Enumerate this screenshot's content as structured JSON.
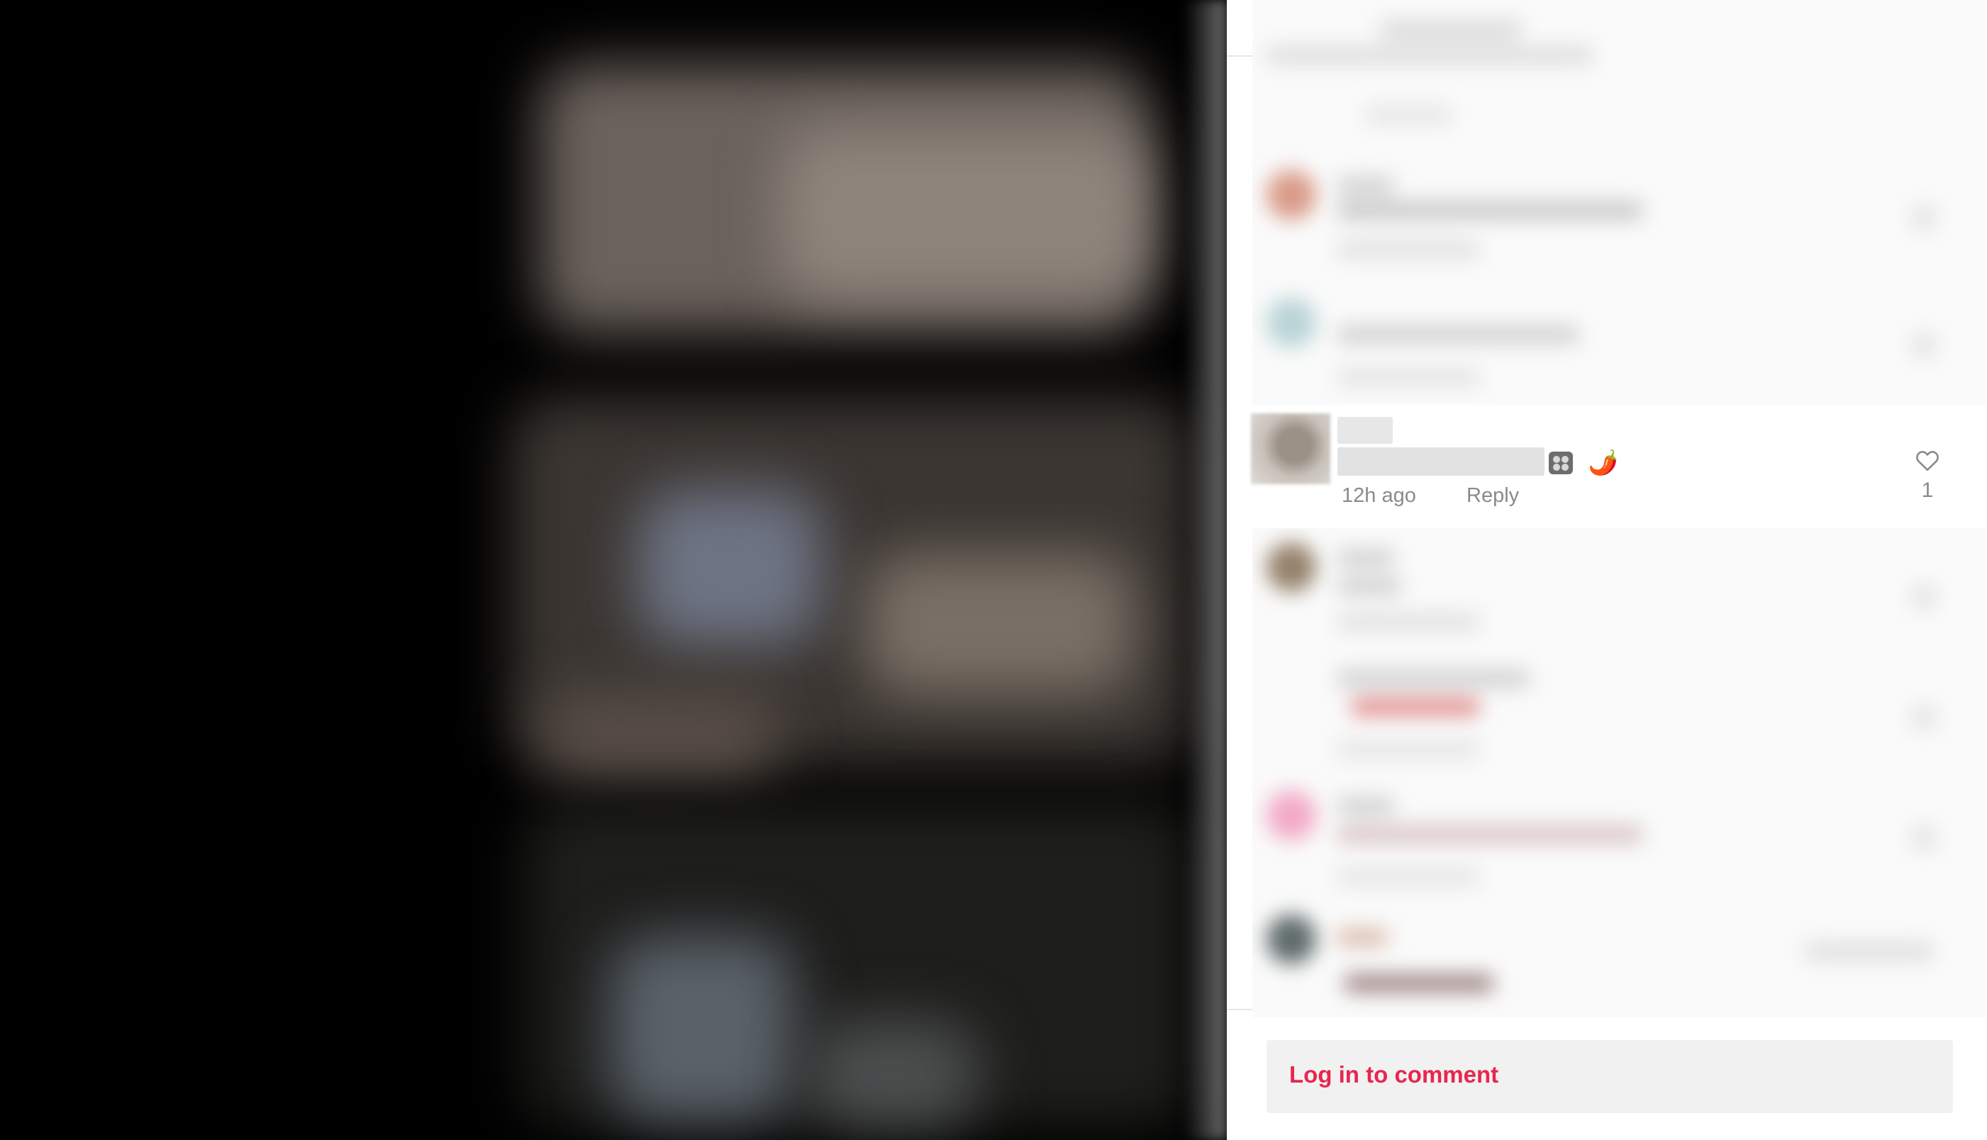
{
  "video": {
    "background": "#000000"
  },
  "comment": {
    "timestamp": "12h ago",
    "reply_label": "Reply",
    "like_count": "1",
    "emojis": [
      "game-dice",
      "chili-pepper"
    ],
    "emoji_2": "🌶️"
  },
  "footer": {
    "login_label": "Log in to comment",
    "accent_color": "#e8264e"
  }
}
